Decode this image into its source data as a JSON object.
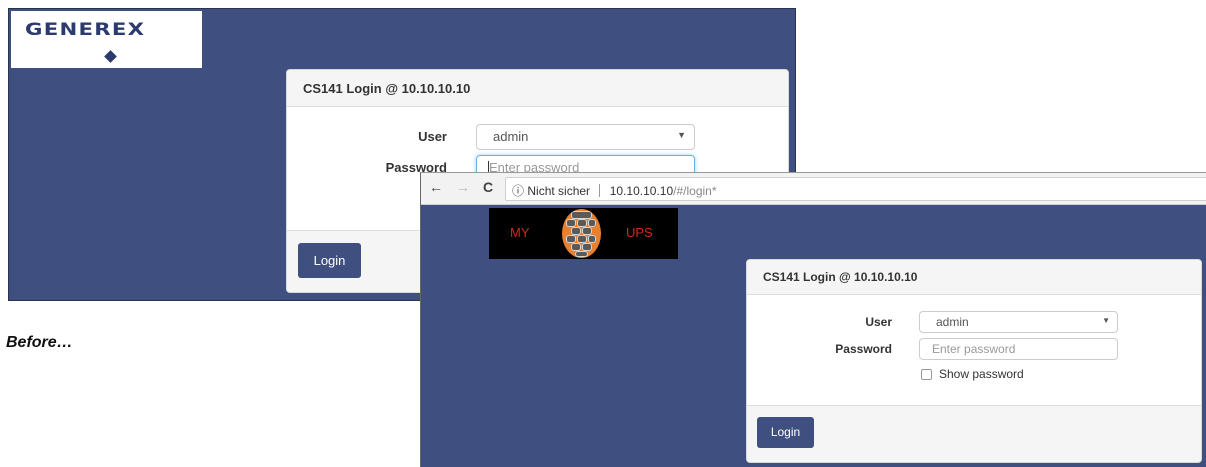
{
  "before": {
    "logo": {
      "text": "GENEREX"
    },
    "login": {
      "title": "CS141 Login @ 10.10.10.10",
      "user_label": "User",
      "user_value": "admin",
      "password_label": "Password",
      "password_placeholder": "Enter password",
      "login_label": "Login"
    },
    "caption": "Before…"
  },
  "after": {
    "browser": {
      "back": "←",
      "forward": "→",
      "reload": "C",
      "security_icon": "ⓘ",
      "security_text": "Nicht sicher",
      "url_host": "10.10.10.10",
      "url_path": "/#/login*"
    },
    "logo": {
      "left_text": "MY",
      "right_text": "UPS"
    },
    "login": {
      "title": "CS141 Login @ 10.10.10.10",
      "user_label": "User",
      "user_value": "admin",
      "password_label": "Password",
      "password_placeholder": "Enter password",
      "show_password_label": "Show password",
      "login_label": "Login"
    }
  },
  "colors": {
    "background": "#3f5080",
    "button": "#3f5080",
    "logo_text": "#2c3a6e",
    "ups_red": "#cc2a1a",
    "emblem_orange": "#e7802f"
  }
}
